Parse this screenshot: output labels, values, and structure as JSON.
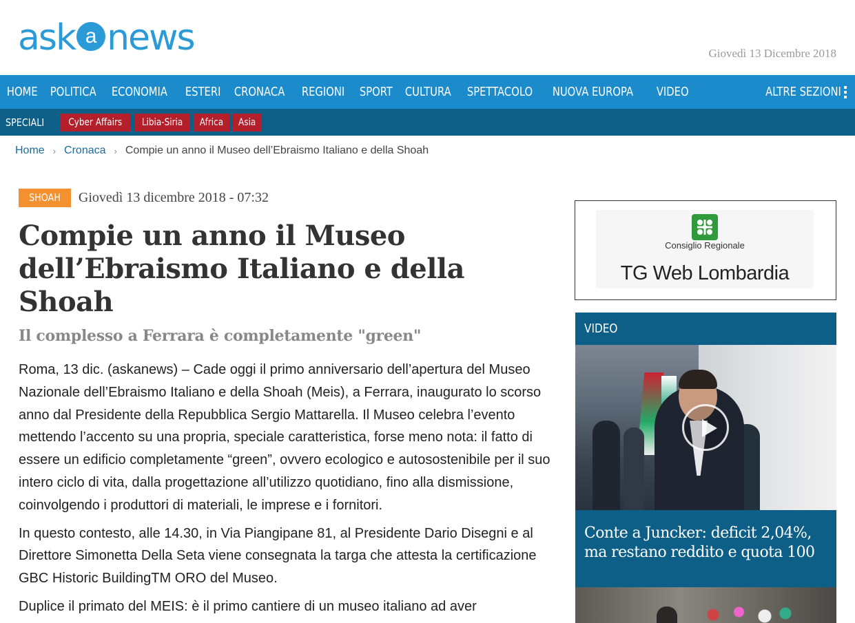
{
  "header": {
    "logo_left": "ask",
    "logo_mid": "a",
    "logo_right": "news",
    "date": "Giovedì 13 Dicembre 2018"
  },
  "nav": {
    "items": [
      "HOME",
      "POLITICA",
      "ECONOMIA",
      "ESTERI",
      "CRONACA",
      "REGIONI",
      "SPORT",
      "CULTURA",
      "SPETTACOLO",
      "NUOVA EUROPA",
      "VIDEO"
    ],
    "more_label": "ALTRE SEZIONI",
    "color": "#1b8bcc"
  },
  "speciali": {
    "label": "SPECIALI",
    "tags": [
      "Cyber Affairs",
      "Libia-Siria",
      "Africa",
      "Asia"
    ],
    "color": "#0d5f87",
    "tag_color": "#b31f2a"
  },
  "breadcrumb": {
    "home": "Home",
    "section": "Cronaca",
    "current": "Compie un anno il Museo dell’Ebraismo Italiano e della Shoah"
  },
  "article": {
    "tag": "SHOAH",
    "tag_color": "#f39131",
    "date": "Giovedì 13 dicembre 2018 - 07:32",
    "title": "Compie un anno il Museo dell’Ebraismo Italiano e della Shoah",
    "subtitle": "Il complesso a Ferrara è completamente \"green\"",
    "paragraphs": [
      "Roma, 13 dic. (askanews) – Cade oggi il primo anniversario dell’apertura del Museo Nazionale dell’Ebraismo Italiano e della Shoah (Meis), a Ferrara, inaugurato lo scorso anno dal Presidente della Repubblica Sergio Mattarella. Il Museo celebra l’evento mettendo l’accento su una propria, speciale caratteristica, forse meno nota: il fatto di essere un edificio completamente “green”, ovvero ecologico e autosostenibile per il suo intero ciclo di vita, dalla progettazione all’utilizzo quotidiano, fino alla dismissione, coinvolgendo i produttori di materiali, le imprese e i fornitori.",
      "In questo contesto, alle 14.30, in Via Piangipane 81, al Presidente Dario Disegni e al Direttore Simonetta Della Seta viene consegnata la targa che attesta la certificazione GBC Historic BuildingTM ORO del Museo.",
      "Duplice il primato del MEIS: è il primo cantiere di un museo italiano ad aver"
    ]
  },
  "ad": {
    "subtitle": "Consiglio Regionale",
    "title": "TG Web Lombardia"
  },
  "video": {
    "heading": "VIDEO",
    "caption": "Conte a Juncker: deficit 2,04%, ma restano reddito e quota 100"
  }
}
